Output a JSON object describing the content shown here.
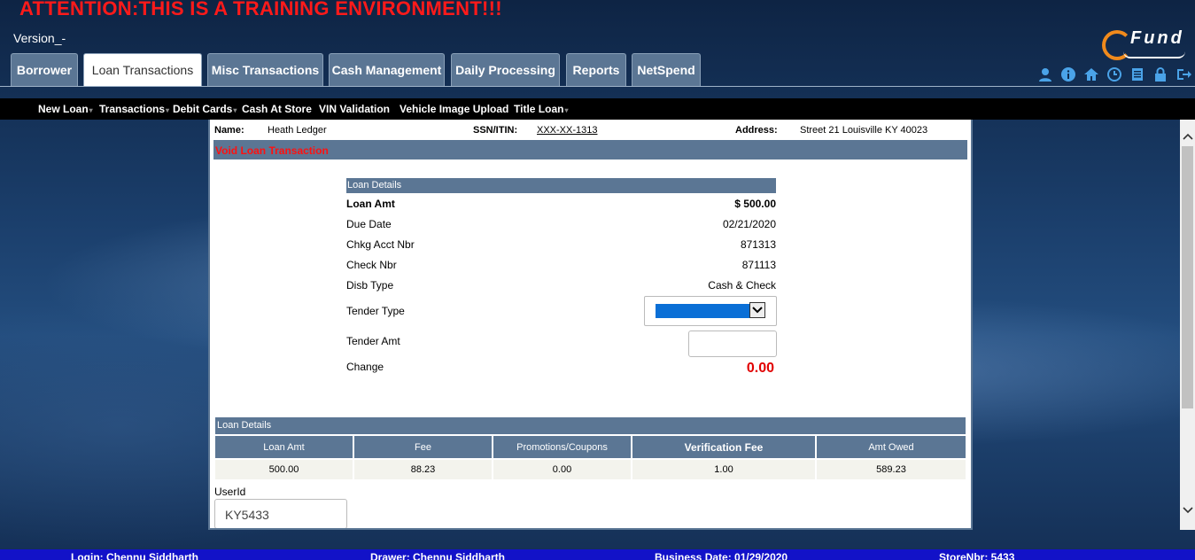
{
  "banner": {
    "training_notice": "ATTENTION:THIS IS A TRAINING ENVIRONMENT!!!"
  },
  "header": {
    "version": "Version_-",
    "logo_text": "Fund"
  },
  "tabs": [
    {
      "label": "Borrower"
    },
    {
      "label": "Loan Transactions"
    },
    {
      "label": "Misc Transactions"
    },
    {
      "label": "Cash Management"
    },
    {
      "label": "Daily Processing"
    },
    {
      "label": "Reports"
    },
    {
      "label": "NetSpend"
    }
  ],
  "active_tab": "Loan Transactions",
  "top_icons": [
    "user-icon",
    "info-icon",
    "home-icon",
    "clock-icon",
    "document-icon",
    "lock-icon",
    "logout-icon"
  ],
  "submenu": [
    {
      "label": "New Loan"
    },
    {
      "label": "Transactions"
    },
    {
      "label": "Debit Cards"
    },
    {
      "label": "Cash At Store"
    },
    {
      "label": "VIN Validation"
    },
    {
      "label": "Vehicle Image Upload"
    },
    {
      "label": "Title Loan"
    }
  ],
  "customer": {
    "name_label": "Name:",
    "name": "Heath  Ledger",
    "ssn_label": "SSN/ITIN:",
    "ssn": "XXX-XX-1313",
    "address_label": "Address:",
    "address": "Street 21  Louisville  KY  40023"
  },
  "page_title": "Void Loan Transaction",
  "loan_details": {
    "heading": "Loan Details",
    "rows": [
      {
        "label": "Loan Amt",
        "value": "$ 500.00"
      },
      {
        "label": "Due Date",
        "value": "02/21/2020"
      },
      {
        "label": "Chkg Acct Nbr",
        "value": "871313"
      },
      {
        "label": "Check Nbr",
        "value": "871113"
      },
      {
        "label": "Disb Type",
        "value": "Cash & Check"
      }
    ],
    "tender_type_label": "Tender Type",
    "tender_type_value": "",
    "tender_amt_label": "Tender Amt",
    "tender_amt_value": "",
    "change_label": "Change",
    "change_value": "0.00"
  },
  "summary": {
    "heading": "Loan Details",
    "columns": [
      "Loan Amt",
      "Fee",
      "Promotions/Coupons",
      "Verification Fee",
      "Amt Owed"
    ],
    "values": [
      "500.00",
      "88.23",
      "0.00",
      "1.00",
      "589.23"
    ]
  },
  "userid": {
    "label": "UserId",
    "value": "KY5433"
  },
  "footer": {
    "login": "Login: Chennu Siddharth",
    "drawer": "Drawer: Chennu Siddharth",
    "business_date": "Business Date: 01/29/2020",
    "store": "StoreNbr: 5433"
  },
  "colors": {
    "accent": "#5b7694",
    "alert": "#ff1a1a",
    "footer": "#1212c8"
  }
}
